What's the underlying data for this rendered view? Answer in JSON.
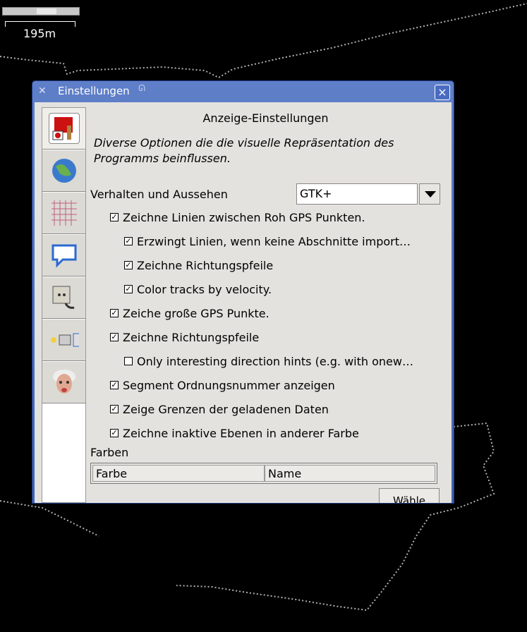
{
  "scale": {
    "label": "195m"
  },
  "dialog": {
    "title": "Einstellungen",
    "close_label": "×",
    "tabs": [
      {
        "icon": "display-settings-icon"
      },
      {
        "icon": "globe-icon"
      },
      {
        "icon": "grid-projection-icon"
      },
      {
        "icon": "speech-bubble-icon"
      },
      {
        "icon": "power-plug-icon"
      },
      {
        "icon": "shortcuts-icon"
      },
      {
        "icon": "einstein-expert-icon"
      }
    ],
    "panel": {
      "title": "Anzeige-Einstellungen",
      "description": "Diverse Optionen die die visuelle Repräsentation des Programms beinflussen.",
      "look_label": "Verhalten und Aussehen",
      "look_value": "GTK+",
      "checks": [
        {
          "label": "Zeichne Linien zwischen Roh GPS Punkten.",
          "checked": true,
          "indent": 1
        },
        {
          "label": "Erzwingt Linien, wenn keine Abschnitte import…",
          "checked": true,
          "indent": 2
        },
        {
          "label": "Zeichne Richtungspfeile",
          "checked": true,
          "indent": 2
        },
        {
          "label": "Color tracks by velocity.",
          "checked": true,
          "indent": 2
        },
        {
          "label": "Zeiche große GPS Punkte.",
          "checked": true,
          "indent": 1
        },
        {
          "label": "Zeichne Richtungspfeile",
          "checked": true,
          "indent": 1
        },
        {
          "label": "Only interesting direction hints (e.g. with onew…",
          "checked": false,
          "indent": 2
        },
        {
          "label": "Segment Ordnungsnummer anzeigen",
          "checked": true,
          "indent": 1
        },
        {
          "label": "Zeige Grenzen der geladenen Daten",
          "checked": true,
          "indent": 1
        },
        {
          "label": "Zeichne inaktive Ebenen in anderer Farbe",
          "checked": true,
          "indent": 1
        }
      ],
      "colors_label": "Farben",
      "table_headers": [
        "Farbe",
        "Name"
      ],
      "choose_label": "Wähle"
    }
  }
}
